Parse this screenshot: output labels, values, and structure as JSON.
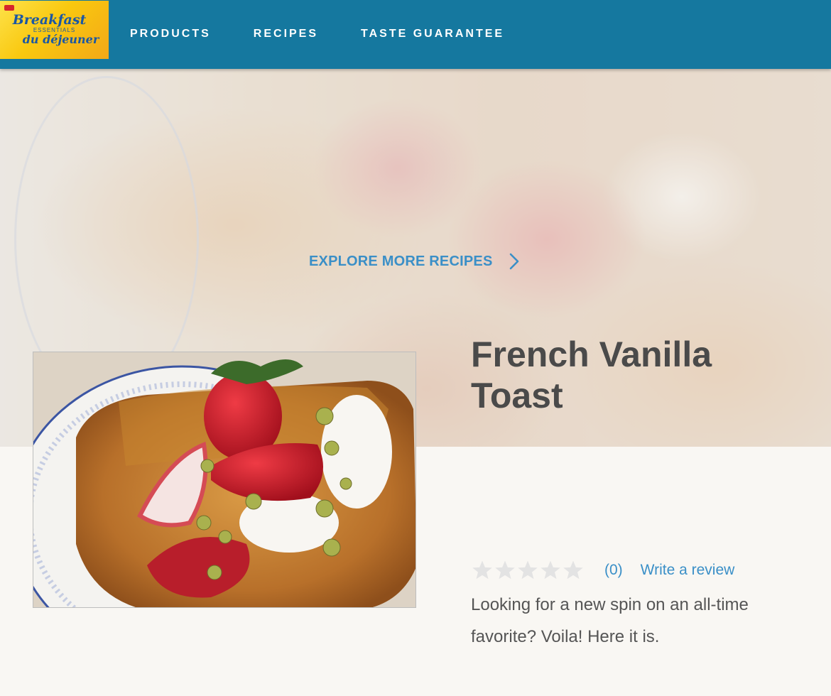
{
  "brand": {
    "logo_line1": "Breakfast",
    "logo_line2": "ESSENTIALS",
    "logo_line3": "du déjeuner"
  },
  "nav": {
    "items": [
      {
        "label": "PRODUCTS"
      },
      {
        "label": "RECIPES"
      },
      {
        "label": "TASTE GUARANTEE"
      }
    ]
  },
  "hero": {
    "explore_label": "EXPLORE MORE RECIPES"
  },
  "recipe": {
    "title": "French Vanilla Toast",
    "rating": {
      "stars": 5,
      "filled": 0,
      "count_label": "(0)",
      "write_label": "Write a review"
    },
    "description": "Looking for a new spin on an all-time favorite? Voila! Here it is."
  },
  "colors": {
    "header_bg": "#15789f",
    "accent_link": "#3a8fc7",
    "star_empty": "#e3e3e3",
    "page_bg": "#f9f7f3"
  }
}
